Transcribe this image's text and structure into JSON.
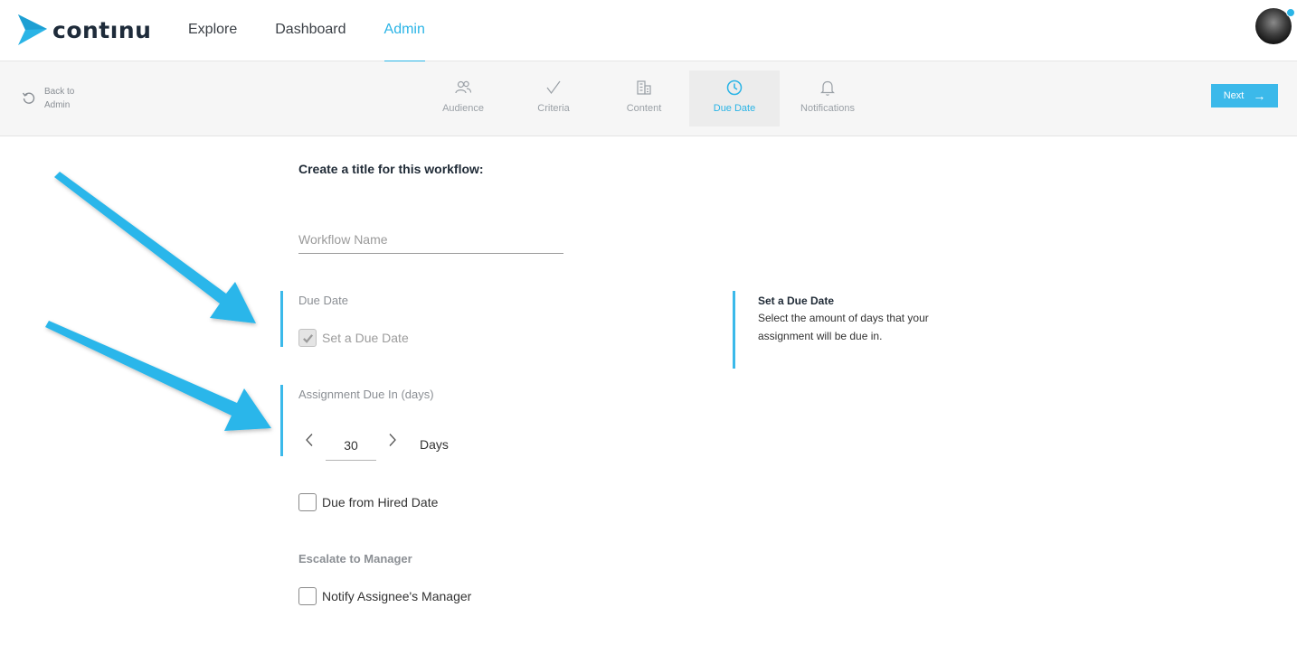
{
  "brand": {
    "name": "contınu",
    "accent": "#2ab4e6"
  },
  "nav": {
    "items": [
      {
        "label": "Explore",
        "active": false
      },
      {
        "label": "Dashboard",
        "active": false
      },
      {
        "label": "Admin",
        "active": true
      }
    ]
  },
  "stepbar": {
    "back_label": "Back to Admin",
    "steps": [
      {
        "label": "Audience",
        "icon": "users-icon",
        "active": false
      },
      {
        "label": "Criteria",
        "icon": "check-icon",
        "active": false
      },
      {
        "label": "Content",
        "icon": "building-icon",
        "active": false
      },
      {
        "label": "Due Date",
        "icon": "clock-icon",
        "active": true
      },
      {
        "label": "Notifications",
        "icon": "bell-icon",
        "active": false
      }
    ],
    "next_label": "Next"
  },
  "form": {
    "title": "Create a title for this workflow:",
    "workflow_name": {
      "value": "",
      "placeholder": "Workflow Name"
    },
    "due_date": {
      "section_label": "Due Date",
      "set_due_date_label": "Set a Due Date",
      "set_due_date_checked": true
    },
    "assignment_due": {
      "section_label": "Assignment Due In (days)",
      "days_value": "30",
      "unit_label": "Days"
    },
    "due_from_hired": {
      "label": "Due from Hired Date",
      "checked": false
    },
    "escalate": {
      "section_label": "Escalate to Manager",
      "notify_label": "Notify Assignee's Manager",
      "notify_checked": false
    }
  },
  "help": {
    "title": "Set a Due Date",
    "body": "Select the amount of days that your assignment will be due in."
  }
}
